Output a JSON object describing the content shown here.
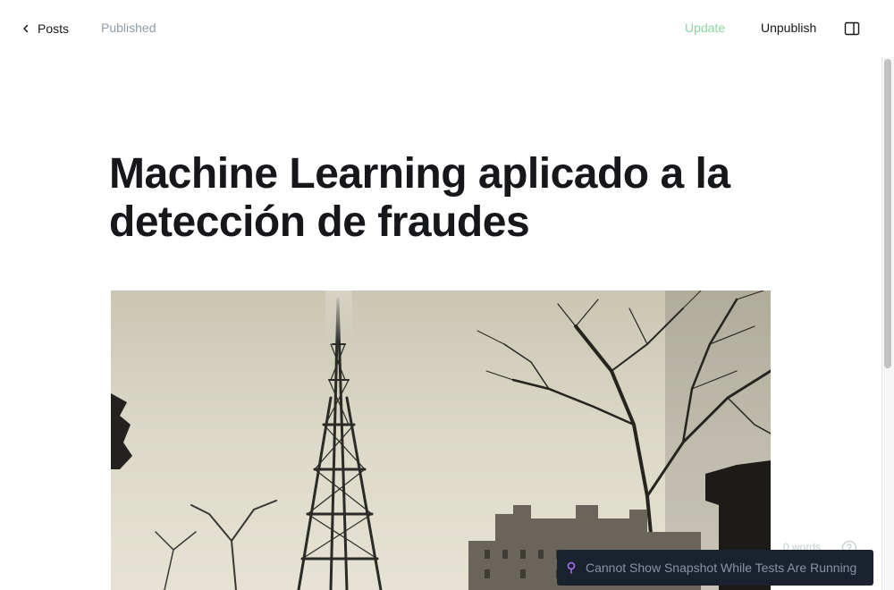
{
  "header": {
    "back_label": "Posts",
    "status": "Published",
    "update_label": "Update",
    "unpublish_label": "Unpublish",
    "sidebar_icon": "sidebar-toggle-icon",
    "back_icon": "chevron-left-icon"
  },
  "post": {
    "title": "Machine Learning aplicado a la detección de fraudes",
    "feature_image_subject": "eiffel-tower-photo"
  },
  "footer": {
    "word_count": "0 words",
    "help_icon": "help-circle-icon"
  },
  "toast": {
    "icon": "pin-icon",
    "message": "Cannot Show Snapshot While Tests Are Running"
  },
  "colors": {
    "update": "#8fd4a0",
    "status": "#8e9cac",
    "text": "#15171a",
    "toast_bg": "#1a2230",
    "toast_text": "#8a94a8",
    "toast_icon": "#a56ef0"
  }
}
